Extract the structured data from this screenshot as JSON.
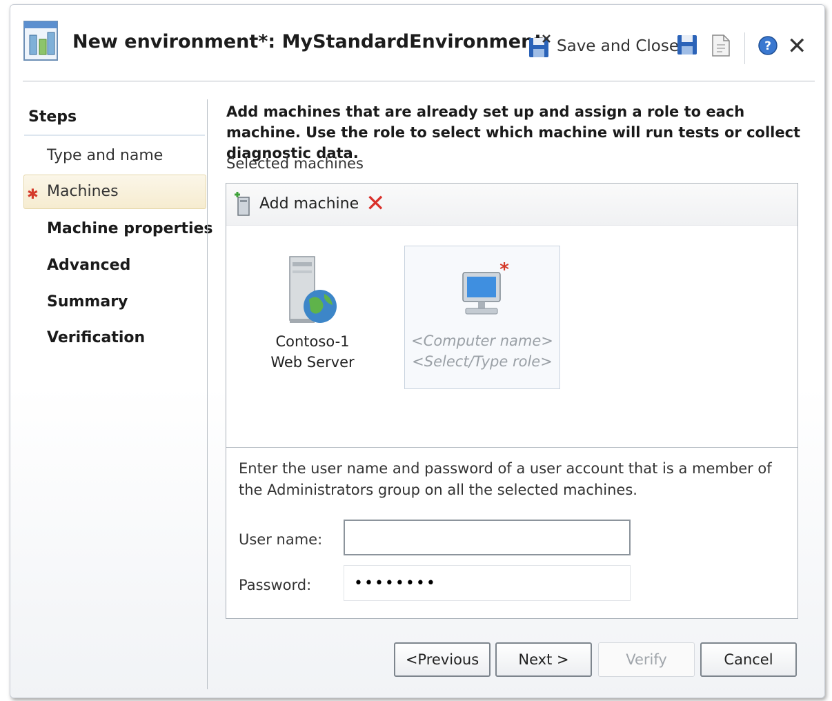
{
  "window": {
    "title": "New environment*: MyStandardEnvironment",
    "header_actions": {
      "save_and_close_label": "Save and Close"
    }
  },
  "sidebar": {
    "title": "Steps",
    "items": [
      {
        "label": "Type and name",
        "state": "completed"
      },
      {
        "label": "Machines",
        "state": "active"
      },
      {
        "label": "Machine properties",
        "state": "pending"
      },
      {
        "label": "Advanced",
        "state": "pending"
      },
      {
        "label": "Summary",
        "state": "pending"
      },
      {
        "label": "Verification",
        "state": "pending"
      }
    ]
  },
  "main": {
    "intro": "Add machines that are already set up and assign a role to each machine. Use the role to select which machine will run tests or collect diagnostic data.",
    "selected_machines_label": "Selected machines",
    "toolbar": {
      "add_machine_label": "Add machine",
      "remove_glyph": "✕"
    },
    "machines": [
      {
        "name": "Contoso-1",
        "role": "Web Server",
        "icon": "web-server-icon"
      },
      {
        "name": "<Computer name>",
        "role": "<Select/Type role>",
        "icon": "computer-icon"
      }
    ],
    "credentials": {
      "instructions": "Enter the user name and password of a user account that is a member of the Administrators group on all the selected machines.",
      "username_label": "User name:",
      "username_value": "",
      "password_label": "Password:",
      "password_value": "••••••••"
    }
  },
  "footer": {
    "previous_label": "<Previous",
    "next_label": "Next >",
    "verify_label": "Verify",
    "cancel_label": "Cancel"
  },
  "colors": {
    "required_star": "#d43a2a",
    "remove_x": "#d9302a",
    "active_step_bg": "#f6ecd0"
  }
}
